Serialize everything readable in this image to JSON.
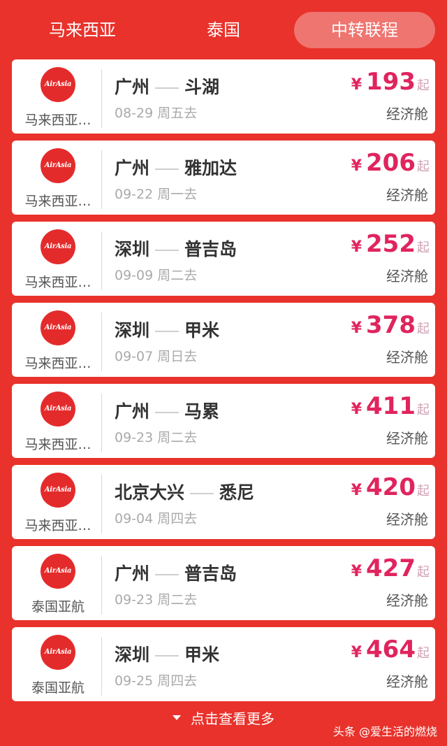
{
  "tabs": [
    {
      "label": "马来西亚"
    },
    {
      "label": "泰国"
    },
    {
      "label": "中转联程"
    }
  ],
  "flights": [
    {
      "logo_text": "AirAsia",
      "airline": "马来西亚…",
      "from": "广州",
      "to": "斗湖",
      "date": "08-29 周五去",
      "yen": "¥",
      "price": "193",
      "suffix": "起",
      "cabin": "经济舱"
    },
    {
      "logo_text": "AirAsia",
      "airline": "马来西亚…",
      "from": "广州",
      "to": "雅加达",
      "date": "09-22 周一去",
      "yen": "¥",
      "price": "206",
      "suffix": "起",
      "cabin": "经济舱"
    },
    {
      "logo_text": "AirAsia",
      "airline": "马来西亚…",
      "from": "深圳",
      "to": "普吉岛",
      "date": "09-09 周二去",
      "yen": "¥",
      "price": "252",
      "suffix": "起",
      "cabin": "经济舱"
    },
    {
      "logo_text": "AirAsia",
      "airline": "马来西亚…",
      "from": "深圳",
      "to": "甲米",
      "date": "09-07 周日去",
      "yen": "¥",
      "price": "378",
      "suffix": "起",
      "cabin": "经济舱"
    },
    {
      "logo_text": "AirAsia",
      "airline": "马来西亚…",
      "from": "广州",
      "to": "马累",
      "date": "09-23 周二去",
      "yen": "¥",
      "price": "411",
      "suffix": "起",
      "cabin": "经济舱"
    },
    {
      "logo_text": "AirAsia",
      "airline": "马来西亚…",
      "from": "北京大兴",
      "to": "悉尼",
      "date": "09-04 周四去",
      "yen": "¥",
      "price": "420",
      "suffix": "起",
      "cabin": "经济舱"
    },
    {
      "logo_text": "AirAsia",
      "airline": "泰国亚航",
      "from": "广州",
      "to": "普吉岛",
      "date": "09-23 周二去",
      "yen": "¥",
      "price": "427",
      "suffix": "起",
      "cabin": "经济舱"
    },
    {
      "logo_text": "AirAsia",
      "airline": "泰国亚航",
      "from": "深圳",
      "to": "甲米",
      "date": "09-25 周四去",
      "yen": "¥",
      "price": "464",
      "suffix": "起",
      "cabin": "经济舱"
    }
  ],
  "more_label": "点击查看更多",
  "watermark": "头条 @爱生活的燃烧",
  "colors": {
    "background": "#e8322b",
    "price": "#e0245e",
    "logo": "#e42b2b"
  }
}
